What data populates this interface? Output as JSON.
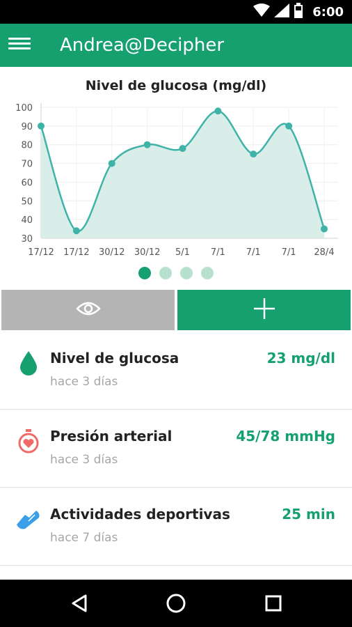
{
  "status_bar": {
    "time": "6:00",
    "icons": [
      "wifi-icon",
      "cellular-signal-icon",
      "battery-icon"
    ]
  },
  "app_bar": {
    "title": "Andrea@Decipher",
    "menu_icon": "hamburger-menu-icon",
    "color": "#16a070"
  },
  "chart_data": {
    "type": "area",
    "title": "Nivel de glucosa (mg/dl)",
    "xlabel": "",
    "ylabel": "",
    "categories": [
      "17/12",
      "17/12",
      "30/12",
      "30/12",
      "5/1",
      "7/1",
      "7/1",
      "7/1",
      "28/4"
    ],
    "series": [
      {
        "values": [
          90,
          34,
          70,
          80,
          78,
          98,
          75,
          90,
          35
        ]
      }
    ],
    "yticks": [
      30,
      40,
      50,
      60,
      70,
      80,
      90,
      100
    ],
    "ylim": [
      30,
      100
    ],
    "grid": true,
    "line_color": "#3fb3a8",
    "fill_color": "#d9eee9"
  },
  "pager": {
    "count": 4,
    "active_index": 0
  },
  "actions": {
    "view_icon": "eye-icon",
    "add_icon": "plus-icon",
    "view_color": "#b4b4b4",
    "add_color": "#16a070"
  },
  "measurements": [
    {
      "icon": "water-drop-icon",
      "icon_color": "#16a070",
      "label": "Nivel de glucosa",
      "time_ago": "hace 3 días",
      "value": "23 mg/dl"
    },
    {
      "icon": "heart-stopwatch-icon",
      "icon_color": "#f06a6a",
      "label": "Presión arterial",
      "time_ago": "hace 3 días",
      "value": "45/78 mmHg"
    },
    {
      "icon": "running-shoe-icon",
      "icon_color": "#3a9ee8",
      "label": "Actividades deportivas",
      "time_ago": "hace 7 días",
      "value": "25 min"
    }
  ],
  "nav_bar": {
    "icons": [
      "back-triangle-icon",
      "home-circle-icon",
      "recents-square-icon"
    ]
  }
}
